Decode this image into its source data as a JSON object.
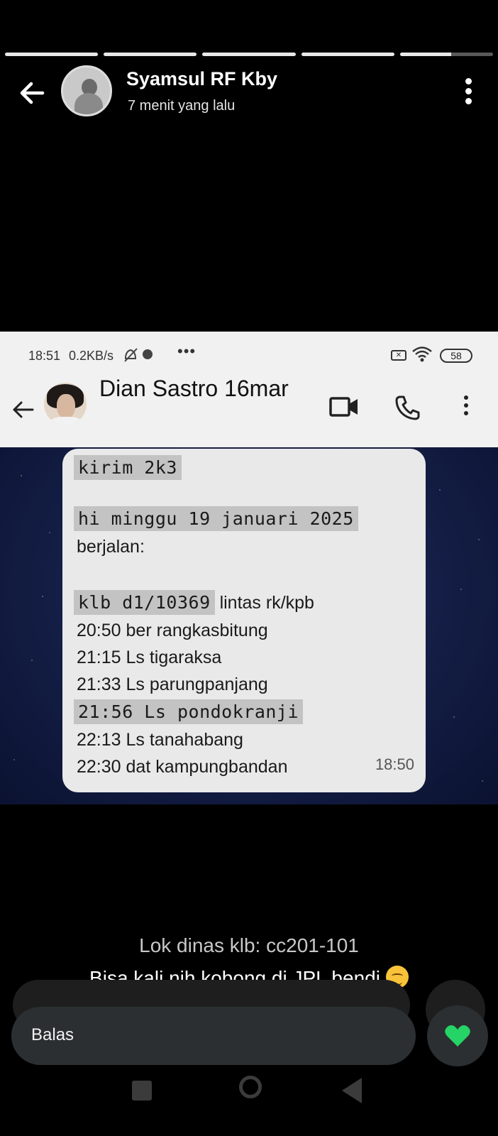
{
  "story": {
    "progress": [
      1,
      1,
      1,
      1,
      0.55
    ]
  },
  "header": {
    "name": "Syamsul RF Kby",
    "time": "7 menit yang lalu"
  },
  "screenshot": {
    "status_bar": {
      "time": "18:51",
      "rate": "0.2KB/s",
      "dots": "•••",
      "sim": "✕",
      "battery": "58"
    },
    "chat_title": "Dian Sastro 16mar",
    "message": {
      "line1": "kirim 2k3",
      "line2": "hi minggu 19 januari 2025",
      "line3": "berjalan:",
      "line4_code": "klb d1/10369",
      "line4_rest": " lintas rk/kpb",
      "line5": "20:50 ber rangkasbitung",
      "line6": "21:15 Ls tigaraksa",
      "line7": "21:33 Ls parungpanjang",
      "line8": "21:56 Ls pondokranji",
      "line9": "22:13 Ls tanahabang",
      "line10": "22:30 dat kampungbandan",
      "time": "18:50"
    }
  },
  "captions": {
    "line1": "Lok dinas klb: cc201-101",
    "line2": "Bisa kali nih kobong di JPL bendi"
  },
  "reply": {
    "label": "Balas"
  },
  "colors": {
    "heart": "#25d366"
  }
}
